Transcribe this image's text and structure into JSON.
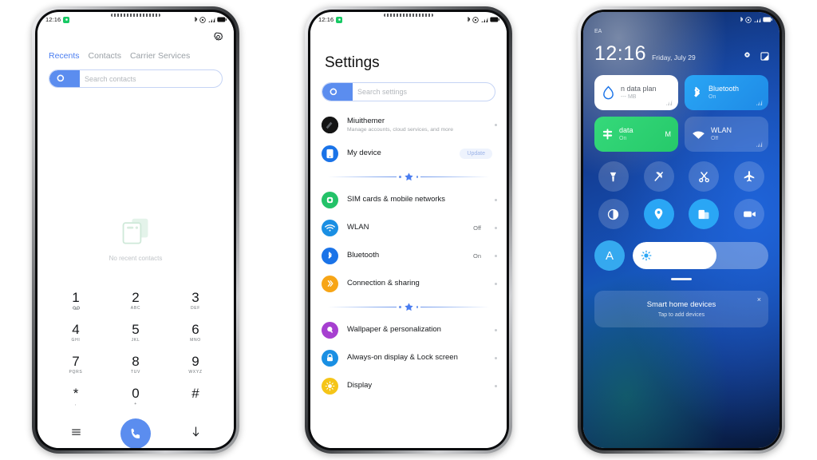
{
  "phones": [
    {
      "id": "dialer",
      "status": {
        "time": "12:16",
        "icons": [
          "bluetooth-icon",
          "dnd-icon",
          "signal-icon",
          "battery-icon"
        ]
      },
      "app": {
        "settings_gear": "gear-icon",
        "tabs": [
          {
            "label": "Recents",
            "active": true
          },
          {
            "label": "Contacts",
            "active": false
          },
          {
            "label": "Carrier Services",
            "active": false
          }
        ],
        "search": {
          "placeholder": "Search contacts",
          "icon": "search-icon"
        },
        "empty": {
          "icon": "no-contacts-icon",
          "text": "No recent contacts"
        },
        "keypad": [
          {
            "digit": "1",
            "sub": ""
          },
          {
            "digit": "2",
            "sub": "ABC"
          },
          {
            "digit": "3",
            "sub": "DEF"
          },
          {
            "digit": "4",
            "sub": "GHI"
          },
          {
            "digit": "5",
            "sub": "JKL"
          },
          {
            "digit": "6",
            "sub": "MNO"
          },
          {
            "digit": "7",
            "sub": "PQRS"
          },
          {
            "digit": "8",
            "sub": "TUV"
          },
          {
            "digit": "9",
            "sub": "WXYZ"
          },
          {
            "digit": "*",
            "sub": ","
          },
          {
            "digit": "0",
            "sub": "+"
          },
          {
            "digit": "#",
            "sub": ""
          }
        ],
        "actions": {
          "menu_icon": "menu-icon",
          "call_icon": "call-icon",
          "hide_icon": "arrow-down-icon"
        }
      }
    },
    {
      "id": "settings",
      "status": {
        "time": "12:16",
        "icons": [
          "bluetooth-icon",
          "dnd-icon",
          "signal-icon",
          "battery-icon"
        ]
      },
      "app": {
        "title": "Settings",
        "search": {
          "placeholder": "Search settings",
          "icon": "search-icon"
        },
        "rows": [
          {
            "title": "Miuithemer",
            "sub": "Manage accounts, cloud services, and more",
            "value": "",
            "icon": "account-avatar",
            "color": "#141414",
            "kind": "avatar"
          },
          {
            "title": "My device",
            "sub": "",
            "value": "",
            "badge": "Update",
            "icon": "device-icon",
            "color": "#1a73e8"
          },
          {
            "kind": "divider"
          },
          {
            "title": "SIM cards & mobile networks",
            "sub": "",
            "value": "",
            "icon": "sim-icon",
            "color": "#23c268"
          },
          {
            "title": "WLAN",
            "sub": "",
            "value": "Off",
            "icon": "wifi-icon",
            "color": "#1a8fe3"
          },
          {
            "title": "Bluetooth",
            "sub": "",
            "value": "On",
            "icon": "bluetooth-icon",
            "color": "#1a73e8"
          },
          {
            "title": "Connection & sharing",
            "sub": "",
            "value": "",
            "icon": "connection-icon",
            "color": "#f7a516"
          },
          {
            "kind": "divider"
          },
          {
            "title": "Wallpaper & personalization",
            "sub": "",
            "value": "",
            "icon": "wallpaper-icon",
            "color": "#a63fd0"
          },
          {
            "title": "Always-on display & Lock screen",
            "sub": "",
            "value": "",
            "icon": "lock-icon",
            "color": "#1a8fe3"
          },
          {
            "title": "Display",
            "sub": "",
            "value": "",
            "icon": "display-icon",
            "color": "#f5c518"
          }
        ]
      }
    },
    {
      "id": "control-center",
      "status": {
        "time": "",
        "icons": [
          "bluetooth-icon",
          "dnd-icon",
          "signal-icon",
          "battery-icon"
        ]
      },
      "app": {
        "carrier": "EA",
        "clock": "12:16",
        "date": "Friday, July 29",
        "header_icons": [
          "settings-icon",
          "screenshot-icon"
        ],
        "tiles": [
          {
            "title": "n data plan",
            "sub": "--- MB",
            "style": "white",
            "icon": "data-drop-icon"
          },
          {
            "title": "Bluetooth",
            "sub": "On",
            "style": "blue",
            "icon": "bluetooth-icon"
          },
          {
            "title": "data",
            "sub": "On",
            "trail": "M",
            "style": "green",
            "icon": "mobile-data-icon"
          },
          {
            "title": "WLAN",
            "sub": "Off",
            "style": "dim",
            "icon": "wifi-icon"
          }
        ],
        "toggles": [
          {
            "icon": "flashlight-icon",
            "on": false
          },
          {
            "icon": "silent-icon",
            "on": false
          },
          {
            "icon": "screenshot-scissors-icon",
            "on": false
          },
          {
            "icon": "airplane-icon",
            "on": false
          },
          {
            "icon": "dark-mode-icon",
            "on": false
          },
          {
            "icon": "location-icon",
            "on": true
          },
          {
            "icon": "cast-icon",
            "on": true
          },
          {
            "icon": "screen-record-icon",
            "on": false
          }
        ],
        "brightness": {
          "auto_label": "A",
          "icon": "brightness-icon",
          "percent": 62
        },
        "smart_home": {
          "title": "Smart home devices",
          "sub": "Tap to add devices",
          "close": "×"
        }
      }
    }
  ],
  "colors": {
    "accent_blue": "#5b8def",
    "tile_blue": "#2aa6f5",
    "tile_green": "#2ecb6f"
  }
}
